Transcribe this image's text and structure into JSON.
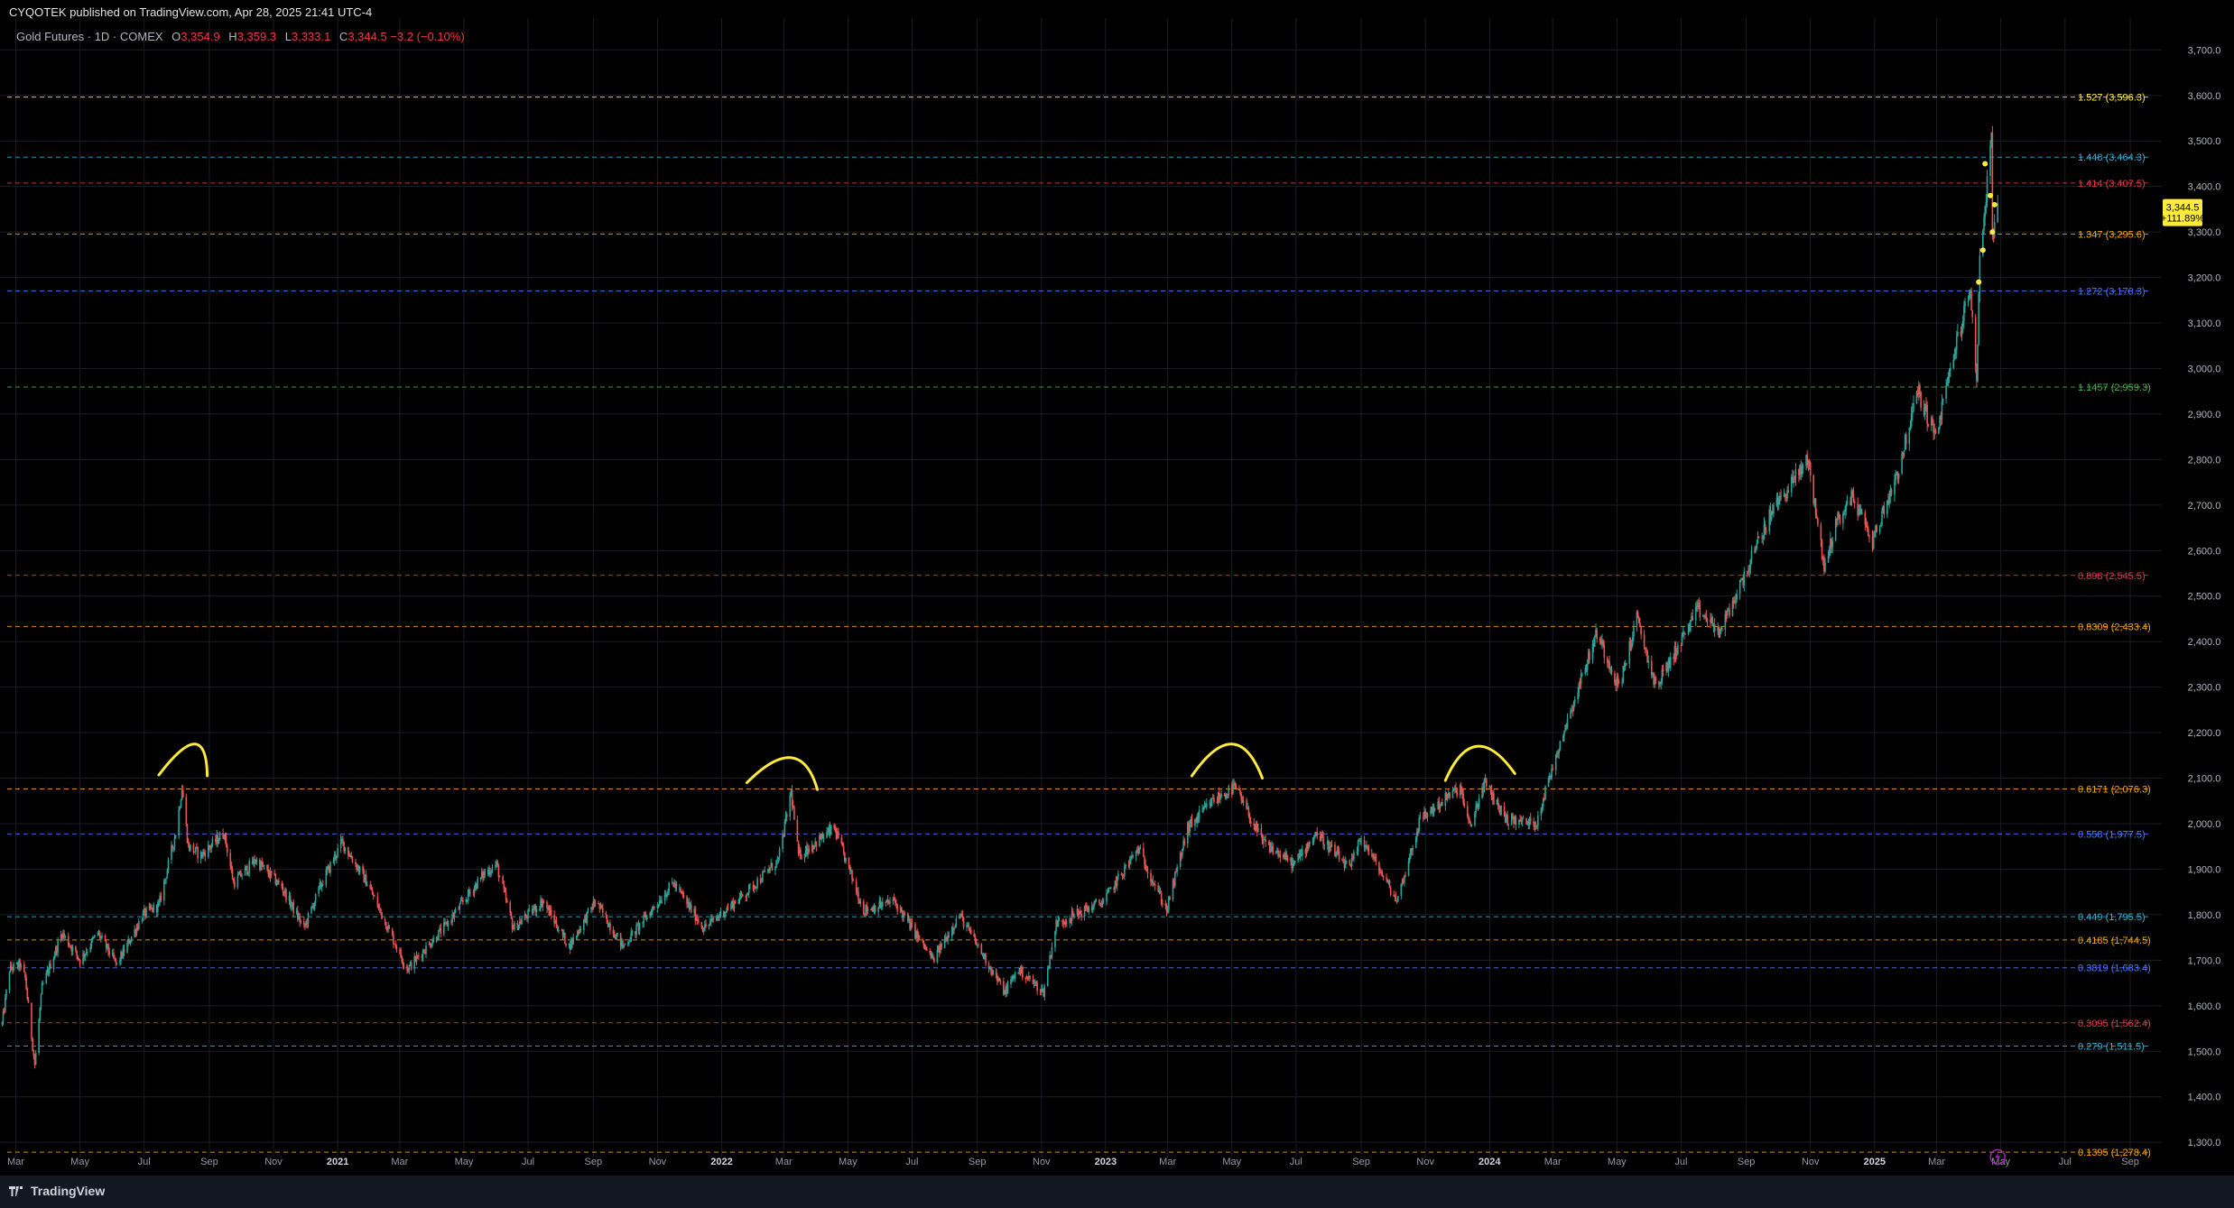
{
  "header": {
    "published": "CYQOTEK published on TradingView.com, Apr 28, 2025 21:41 UTC-4"
  },
  "symbol_bar": {
    "name": "Gold Futures · 1D · COMEX",
    "o_label": "O",
    "o_value": "3,354.9",
    "h_label": "H",
    "h_value": "3,359.3",
    "l_label": "L",
    "l_value": "3,333.1",
    "c_label": "C",
    "c_value": "3,344.5",
    "change": "−3.2 (−0.10%)"
  },
  "footer": {
    "brand": "TradingView"
  },
  "colors": {
    "up": "#26a69a",
    "down": "#ef5350",
    "annotation": "#ffeb3b",
    "price_label_bg": "#ffeb3b",
    "alert": "#9c27b0"
  },
  "chart_data": {
    "type": "candlestick",
    "title": "Gold Futures · 1D · COMEX",
    "price_axis": {
      "range": [
        1227,
        3770
      ],
      "ticks": [
        "1,300.0",
        "1,400.0",
        "1,500.0",
        "1,600.0",
        "1,700.0",
        "1,800.0",
        "1,900.0",
        "2,000.0",
        "2,100.0",
        "2,200.0",
        "2,300.0",
        "2,400.0",
        "2,500.0",
        "2,600.0",
        "2,700.0",
        "2,800.0",
        "2,900.0",
        "3,000.0",
        "3,100.0",
        "3,200.0",
        "3,300.0",
        "3,400.0",
        "3,500.0",
        "3,600.0",
        "3,700.0"
      ]
    },
    "time_axis": {
      "range": [
        "2020-02-15",
        "2025-10-01"
      ],
      "labels": [
        {
          "t": "2020-03-01",
          "text": "Mar"
        },
        {
          "t": "2020-05-01",
          "text": "May"
        },
        {
          "t": "2020-07-01",
          "text": "Jul"
        },
        {
          "t": "2020-09-01",
          "text": "Sep"
        },
        {
          "t": "2020-11-01",
          "text": "Nov"
        },
        {
          "t": "2021-01-01",
          "text": "2021"
        },
        {
          "t": "2021-03-01",
          "text": "Mar"
        },
        {
          "t": "2021-05-01",
          "text": "May"
        },
        {
          "t": "2021-07-01",
          "text": "Jul"
        },
        {
          "t": "2021-09-01",
          "text": "Sep"
        },
        {
          "t": "2021-11-01",
          "text": "Nov"
        },
        {
          "t": "2022-01-01",
          "text": "2022"
        },
        {
          "t": "2022-03-01",
          "text": "Mar"
        },
        {
          "t": "2022-05-01",
          "text": "May"
        },
        {
          "t": "2022-07-01",
          "text": "Jul"
        },
        {
          "t": "2022-09-01",
          "text": "Sep"
        },
        {
          "t": "2022-11-01",
          "text": "Nov"
        },
        {
          "t": "2023-01-01",
          "text": "2023"
        },
        {
          "t": "2023-03-01",
          "text": "Mar"
        },
        {
          "t": "2023-05-01",
          "text": "May"
        },
        {
          "t": "2023-07-01",
          "text": "Jul"
        },
        {
          "t": "2023-09-01",
          "text": "Sep"
        },
        {
          "t": "2023-11-01",
          "text": "Nov"
        },
        {
          "t": "2024-01-01",
          "text": "2024"
        },
        {
          "t": "2024-03-01",
          "text": "Mar"
        },
        {
          "t": "2024-05-01",
          "text": "May"
        },
        {
          "t": "2024-07-01",
          "text": "Jul"
        },
        {
          "t": "2024-09-01",
          "text": "Sep"
        },
        {
          "t": "2024-11-01",
          "text": "Nov"
        },
        {
          "t": "2025-01-01",
          "text": "2025"
        },
        {
          "t": "2025-03-01",
          "text": "Mar"
        },
        {
          "t": "2025-05-01",
          "text": "May"
        },
        {
          "t": "2025-07-01",
          "text": "Jul"
        },
        {
          "t": "2025-09-01",
          "text": "Sep"
        }
      ]
    },
    "grid": true,
    "price_path": [
      [
        "2020-02-17",
        1560
      ],
      [
        "2020-02-24",
        1680
      ],
      [
        "2020-03-05",
        1690
      ],
      [
        "2020-03-10",
        1660
      ],
      [
        "2020-03-19",
        1470
      ],
      [
        "2020-03-26",
        1640
      ],
      [
        "2020-04-14",
        1760
      ],
      [
        "2020-05-01",
        1700
      ],
      [
        "2020-05-18",
        1760
      ],
      [
        "2020-06-05",
        1690
      ],
      [
        "2020-06-30",
        1800
      ],
      [
        "2020-07-15",
        1820
      ],
      [
        "2020-07-31",
        1980
      ],
      [
        "2020-08-06",
        2080
      ],
      [
        "2020-08-12",
        1950
      ],
      [
        "2020-08-24",
        1930
      ],
      [
        "2020-09-15",
        1980
      ],
      [
        "2020-09-24",
        1870
      ],
      [
        "2020-10-15",
        1920
      ],
      [
        "2020-11-09",
        1860
      ],
      [
        "2020-11-30",
        1770
      ],
      [
        "2020-12-15",
        1860
      ],
      [
        "2021-01-05",
        1960
      ],
      [
        "2021-01-29",
        1870
      ],
      [
        "2021-03-08",
        1680
      ],
      [
        "2021-04-15",
        1780
      ],
      [
        "2021-05-20",
        1890
      ],
      [
        "2021-06-01",
        1910
      ],
      [
        "2021-06-17",
        1770
      ],
      [
        "2021-07-15",
        1830
      ],
      [
        "2021-08-09",
        1730
      ],
      [
        "2021-09-03",
        1830
      ],
      [
        "2021-09-29",
        1730
      ],
      [
        "2021-11-16",
        1870
      ],
      [
        "2021-12-15",
        1770
      ],
      [
        "2022-01-25",
        1850
      ],
      [
        "2022-02-24",
        1920
      ],
      [
        "2022-03-08",
        2070
      ],
      [
        "2022-03-15",
        1930
      ],
      [
        "2022-04-18",
        1990
      ],
      [
        "2022-05-16",
        1810
      ],
      [
        "2022-06-14",
        1830
      ],
      [
        "2022-07-21",
        1700
      ],
      [
        "2022-08-15",
        1800
      ],
      [
        "2022-09-27",
        1630
      ],
      [
        "2022-10-10",
        1680
      ],
      [
        "2022-11-03",
        1630
      ],
      [
        "2022-11-15",
        1780
      ],
      [
        "2022-12-30",
        1830
      ],
      [
        "2023-02-01",
        1945
      ],
      [
        "2023-02-28",
        1810
      ],
      [
        "2023-03-20",
        1990
      ],
      [
        "2023-04-13",
        2050
      ],
      [
        "2023-05-04",
        2080
      ],
      [
        "2023-05-30",
        1960
      ],
      [
        "2023-06-29",
        1910
      ],
      [
        "2023-07-20",
        1980
      ],
      [
        "2023-08-21",
        1900
      ],
      [
        "2023-09-01",
        1970
      ],
      [
        "2023-10-05",
        1830
      ],
      [
        "2023-10-27",
        2010
      ],
      [
        "2023-12-04",
        2080
      ],
      [
        "2023-12-13",
        1990
      ],
      [
        "2023-12-27",
        2090
      ],
      [
        "2024-01-17",
        2010
      ],
      [
        "2024-02-14",
        2000
      ],
      [
        "2024-03-08",
        2180
      ],
      [
        "2024-04-12",
        2420
      ],
      [
        "2024-05-03",
        2300
      ],
      [
        "2024-05-20",
        2450
      ],
      [
        "2024-06-07",
        2300
      ],
      [
        "2024-07-17",
        2470
      ],
      [
        "2024-08-07",
        2420
      ],
      [
        "2024-09-26",
        2690
      ],
      [
        "2024-10-30",
        2800
      ],
      [
        "2024-11-14",
        2560
      ],
      [
        "2024-11-25",
        2660
      ],
      [
        "2024-12-11",
        2720
      ],
      [
        "2024-12-30",
        2620
      ],
      [
        "2025-01-24",
        2780
      ],
      [
        "2025-02-11",
        2950
      ],
      [
        "2025-02-28",
        2850
      ],
      [
        "2025-03-20",
        3060
      ],
      [
        "2025-04-02",
        3170
      ],
      [
        "2025-04-08",
        2980
      ],
      [
        "2025-04-11",
        3240
      ],
      [
        "2025-04-22",
        3500
      ],
      [
        "2025-04-23",
        3300
      ],
      [
        "2025-04-28",
        3345
      ]
    ],
    "fibonacci_levels": [
      {
        "ratio": "0.1395",
        "price": 1278.4,
        "label": "0.1395 (1,278.4)",
        "color": "#f7a600"
      },
      {
        "ratio": "0.279",
        "price": 1511.5,
        "label": "0.279 (1,511.5)",
        "color": "#2fb4d6"
      },
      {
        "ratio": "0.3095",
        "price": 1562.4,
        "label": "0.3095 (1,562.4)",
        "color": "#e53945"
      },
      {
        "ratio": "0.3819",
        "price": 1683.4,
        "label": "0.3819 (1,683.4)",
        "color": "#4c78ff"
      },
      {
        "ratio": "0.4185",
        "price": 1744.5,
        "label": "0.4185 (1,744.5)",
        "color": "#f7a600"
      },
      {
        "ratio": "0.449",
        "price": 1795.5,
        "label": "0.449 (1,795.5)",
        "color": "#2fb4d6"
      },
      {
        "ratio": "0.558",
        "price": 1977.5,
        "label": "0.558 (1,977.5)",
        "color": "#4c78ff"
      },
      {
        "ratio": "0.6171",
        "price": 2076.3,
        "label": "0.6171 (2,076.3)",
        "color": "#f7a600"
      },
      {
        "ratio": "0.8309",
        "price": 2433.4,
        "label": "0.8309 (2,433.4)",
        "color": "#f7a600"
      },
      {
        "ratio": "0.898",
        "price": 2545.5,
        "label": "0.898 (2,545.5)",
        "color": "#e53945"
      },
      {
        "ratio": "1.1457",
        "price": 2959.3,
        "label": "1.1457 (2,959.3)",
        "color": "#4caf50"
      },
      {
        "ratio": "1.272",
        "price": 3170.3,
        "label": "1.272 (3,170.3)",
        "color": "#4c78ff"
      },
      {
        "ratio": "1.347",
        "price": 3295.6,
        "label": "1.347 (3,295.6)",
        "color": "#f7a600"
      },
      {
        "ratio": "1.414",
        "price": 3407.5,
        "label": "1.414 (3,407.5)",
        "color": "#e53945"
      },
      {
        "ratio": "1.448",
        "price": 3464.3,
        "label": "1.448 (3,464.3)",
        "color": "#2fb4d6"
      },
      {
        "ratio": "1.527",
        "price": 3596.3,
        "label": "1.527 (3,596.3)",
        "color": "#ffeb3b"
      }
    ],
    "peak_arcs": [
      {
        "start": [
          "2020-07-15",
          2107
        ],
        "mid": [
          "2020-08-18",
          2175
        ],
        "end": [
          "2020-08-30",
          2105
        ]
      },
      {
        "start": [
          "2022-01-25",
          2090
        ],
        "mid": [
          "2022-03-08",
          2145
        ],
        "end": [
          "2022-04-02",
          2075
        ]
      },
      {
        "start": [
          "2023-03-24",
          2105
        ],
        "mid": [
          "2023-05-01",
          2175
        ],
        "end": [
          "2023-05-30",
          2100
        ]
      },
      {
        "start": [
          "2023-11-20",
          2095
        ],
        "mid": [
          "2023-12-20",
          2170
        ],
        "end": [
          "2024-01-25",
          2110
        ]
      }
    ],
    "current_price": {
      "value": 3344.5,
      "label": "3,344.5",
      "change": "+111.89%"
    }
  }
}
